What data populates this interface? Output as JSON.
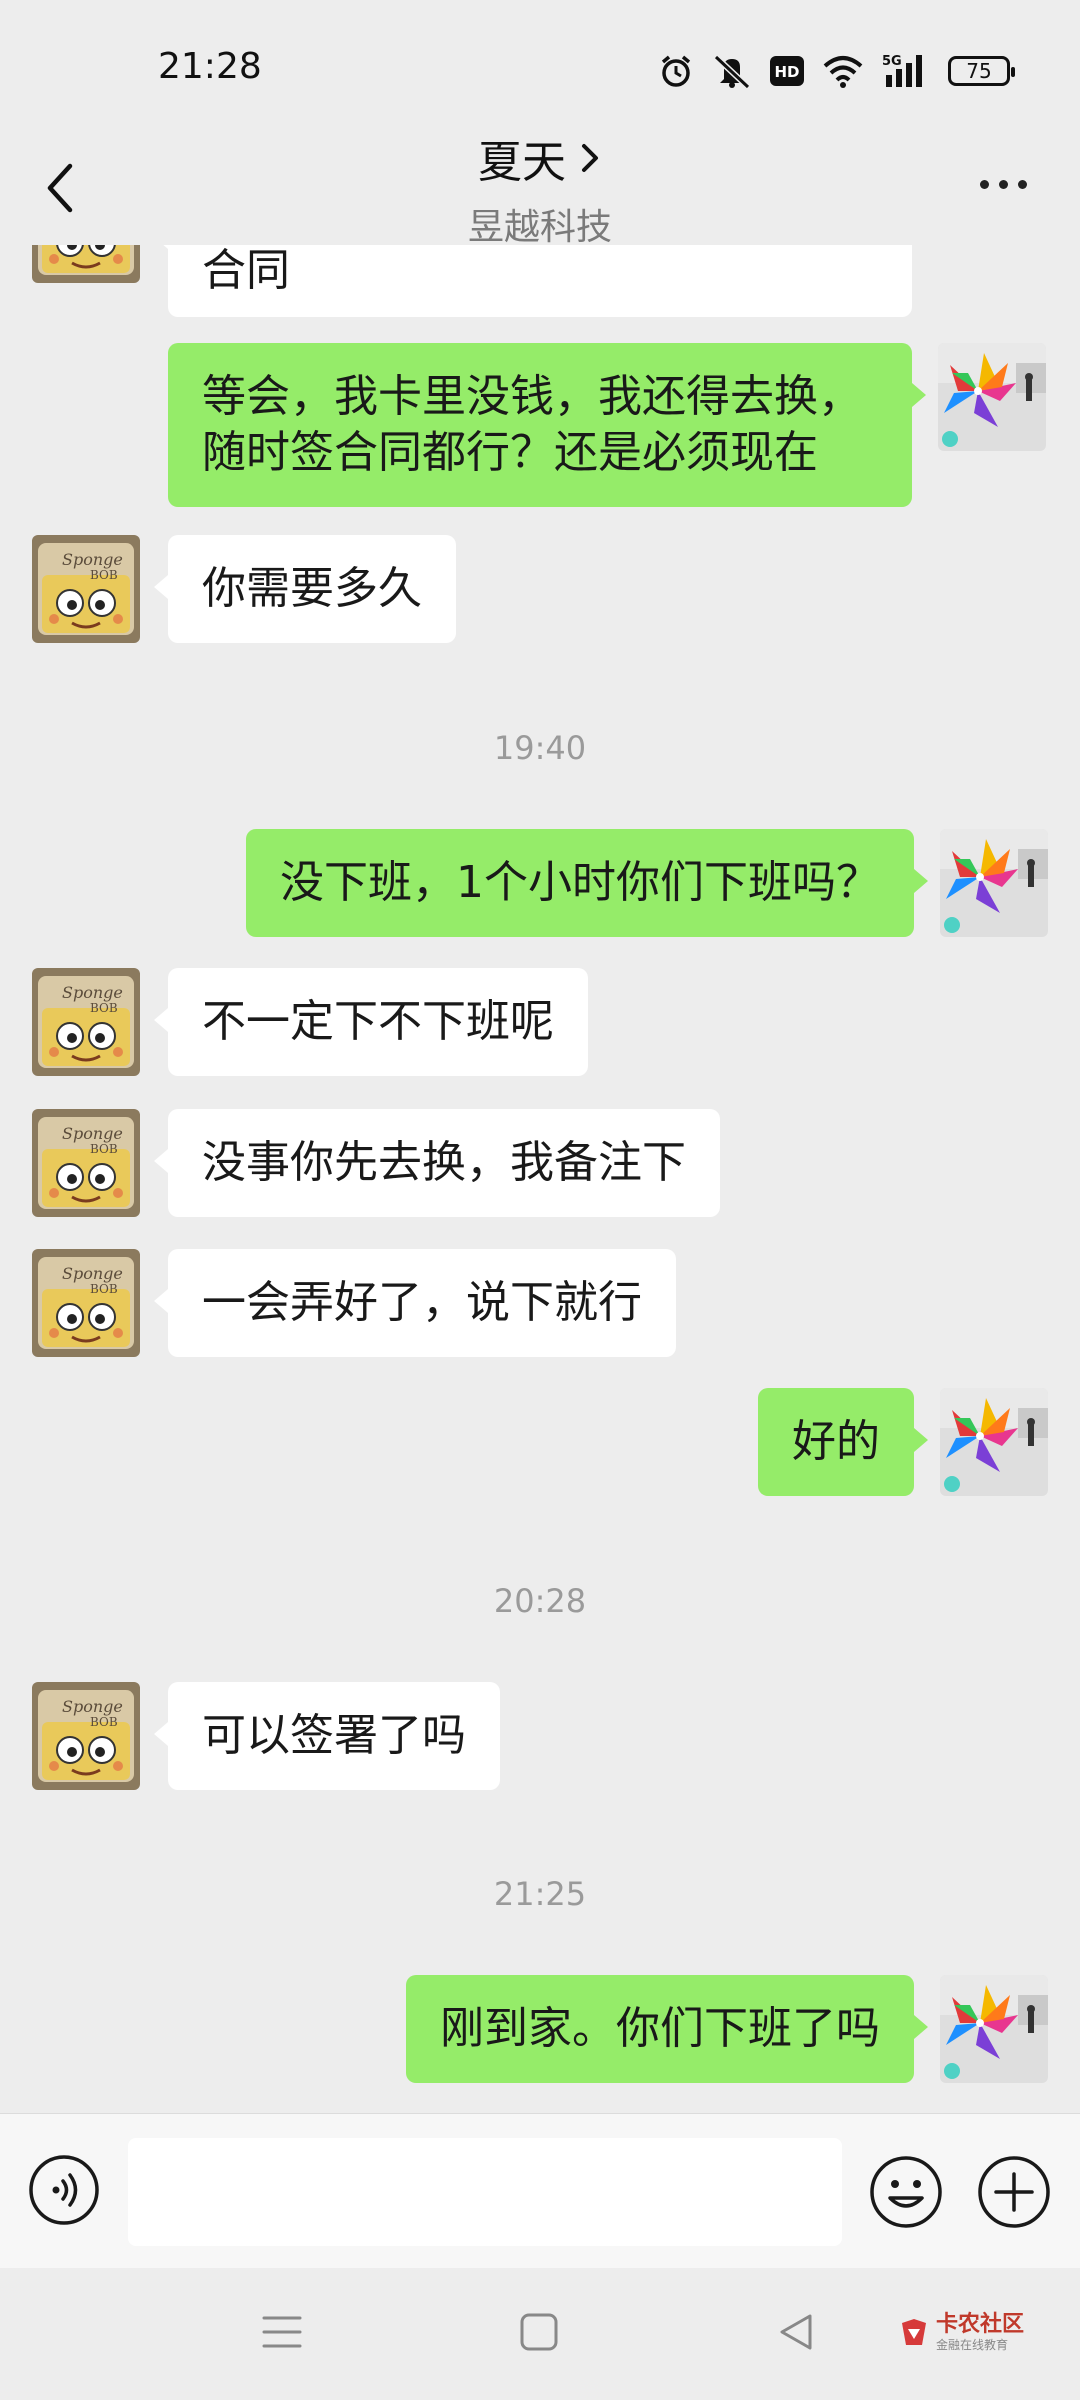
{
  "status_bar": {
    "time": "21:28",
    "network": "5G",
    "hd_label": "HD",
    "battery": "75",
    "icons": [
      "alarm-icon",
      "mute-icon",
      "hd-icon",
      "wifi-icon",
      "signal-icon",
      "battery-icon"
    ]
  },
  "header": {
    "title": "夏天",
    "subtitle": "昱越科技",
    "back_icon": "chevron-left-icon",
    "more_icon": "more-dots-icon"
  },
  "messages": [
    {
      "type": "in",
      "text": "合同"
    },
    {
      "type": "out",
      "text": "等会，我卡里没钱，我还得去换，随时签合同都行？还是必须现在"
    },
    {
      "type": "in",
      "text": "你需要多久"
    },
    {
      "type": "time",
      "text": "19:40"
    },
    {
      "type": "out",
      "text": "没下班，1个小时你们下班吗？"
    },
    {
      "type": "in",
      "text": "不一定下不下班呢"
    },
    {
      "type": "in",
      "text": "没事你先去换，我备注下"
    },
    {
      "type": "in",
      "text": "一会弄好了，说下就行"
    },
    {
      "type": "out",
      "text": "好的"
    },
    {
      "type": "time",
      "text": "20:28"
    },
    {
      "type": "in",
      "text": "可以签署了吗"
    },
    {
      "type": "time",
      "text": "21:25"
    },
    {
      "type": "out",
      "text": "刚到家。你们下班了吗"
    }
  ],
  "input_bar": {
    "placeholder": "",
    "voice_icon": "voice-icon",
    "emoji_icon": "emoji-icon",
    "plus_icon": "plus-icon"
  },
  "nav_bar": {
    "icons": [
      "menu-icon",
      "home-square-icon",
      "back-triangle-icon"
    ]
  },
  "watermark": {
    "main": "卡农社区",
    "sub": "金融在线教育"
  },
  "colors": {
    "background": "#ededed",
    "bubble_out": "#95ec69",
    "bubble_in": "#ffffff",
    "timestamp": "#9a9a9a"
  }
}
